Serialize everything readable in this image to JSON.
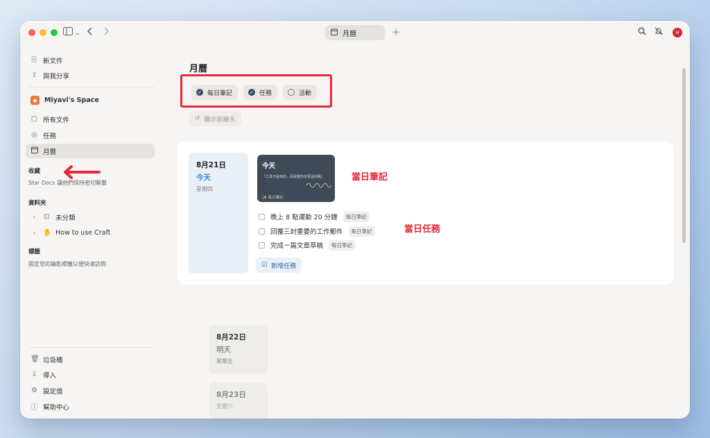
{
  "window": {
    "tab_label": "月曆",
    "avatar_initial": "M"
  },
  "sidebar": {
    "top_items": [
      {
        "label": "新文件",
        "icon": "new-doc-icon"
      },
      {
        "label": "與我分享",
        "icon": "share-icon"
      }
    ],
    "space_name": "Miyavi's Space",
    "space_items": [
      {
        "label": "所有文件",
        "icon": "documents-icon"
      },
      {
        "label": "任務",
        "icon": "task-check-icon"
      },
      {
        "label": "月曆",
        "icon": "calendar-icon",
        "active": true
      }
    ],
    "favorites_title": "收藏",
    "favorites_hint": "Star Docs 讓他們保持密切聯繫",
    "folders_title": "資料夾",
    "folders": [
      {
        "label": "未分類",
        "icon": "inbox-icon"
      },
      {
        "label": "How to use Craft",
        "icon": "wave-emoji-icon"
      }
    ],
    "tags_title": "標籤",
    "tags_hint": "固定您的鑰匙標籤以便快速訪問",
    "bottom_items": [
      {
        "label": "垃圾桶",
        "icon": "trash-icon"
      },
      {
        "label": "導入",
        "icon": "import-icon"
      },
      {
        "label": "設定值",
        "icon": "settings-icon"
      },
      {
        "label": "幫助中心",
        "icon": "help-icon"
      }
    ]
  },
  "main": {
    "title": "月曆",
    "filters": [
      {
        "label": "每日筆記",
        "checked": true
      },
      {
        "label": "任務",
        "checked": true
      },
      {
        "label": "活動",
        "checked": false
      }
    ],
    "show_previous_label": "顯示前幾天",
    "today": {
      "date": "8月21日",
      "relative": "今天",
      "weekday": "星期四",
      "note_title": "今天",
      "note_excerpt": "「工具不是目的，而是幫你走更遠的路」",
      "note_footer": "每日筆記",
      "tasks": [
        {
          "text": "晚上 8 點運動 20 分鐘",
          "tag": "每日筆記"
        },
        {
          "text": "回覆三封重要的工作郵件",
          "tag": "每日筆記"
        },
        {
          "text": "完成一篇文章草稿",
          "tag": "每日筆記"
        }
      ],
      "add_task_label": "新增任務"
    },
    "next_days": [
      {
        "date": "8月22日",
        "relative": "明天",
        "weekday": "星期五"
      },
      {
        "date": "8月23日",
        "relative": "",
        "weekday": "星期六"
      }
    ]
  },
  "annotations": {
    "daily_note": "當日筆記",
    "daily_tasks": "當日任務"
  },
  "colors": {
    "annotation_red": "#e6283a",
    "today_blue": "#3a82d6",
    "chip_check": "#3b4f6b"
  }
}
